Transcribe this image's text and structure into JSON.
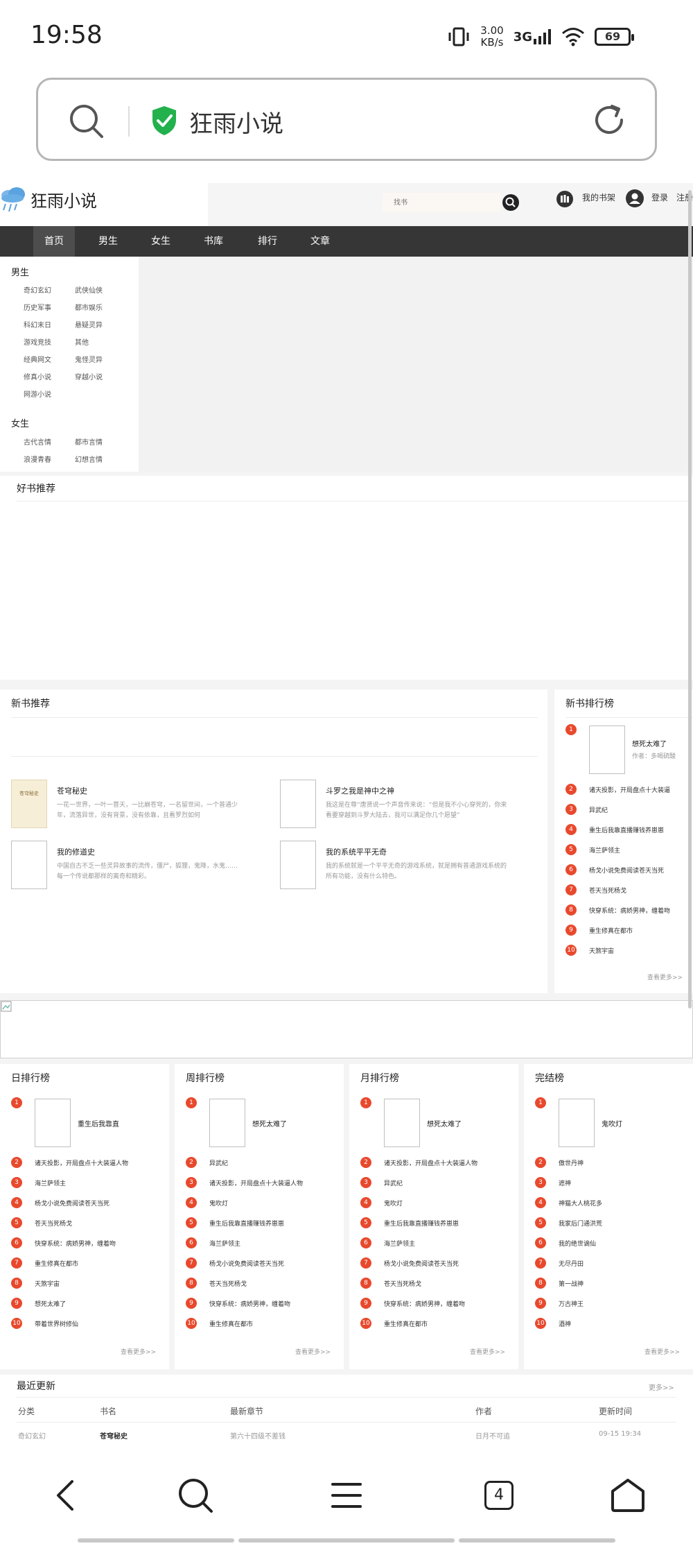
{
  "status": {
    "time": "19:58",
    "net_speed_value": "3.00",
    "net_speed_unit": "KB/s",
    "signal": "3G",
    "battery": "69"
  },
  "address_bar": {
    "site_title": "狂雨小说"
  },
  "site": {
    "logo": "狂雨小说",
    "search_placeholder": "找书",
    "bookshelf": "我的书架",
    "login": "登录",
    "register": "注册"
  },
  "nav": [
    "首页",
    "男生",
    "女生",
    "书库",
    "排行",
    "文章"
  ],
  "categories": {
    "male_title": "男生",
    "male": [
      "奇幻玄幻",
      "武侠仙侠",
      "历史军事",
      "都市娱乐",
      "科幻末日",
      "悬疑灵异",
      "游戏竞技",
      "其他",
      "经典网文",
      "鬼怪灵异",
      "修真小说",
      "穿越小说",
      "网游小说"
    ],
    "female_title": "女生",
    "female": [
      "古代言情",
      "都市言情",
      "浪漫青春",
      "幻想言情"
    ]
  },
  "good_books": {
    "title": "好书推荐"
  },
  "new_books": {
    "title": "新书推荐",
    "items": [
      {
        "title": "苍穹秘史",
        "desc": "一花一世界，一叶一菩天，一比崩苍穹，一名留世间，一个普通少年，流落异世，没有背景，没有依靠，且看罗烈如何",
        "cover_text": "苍穹秘史"
      },
      {
        "title": "斗罗之我是神中之神",
        "desc": "我这是在尊“唐贤说一个声音传来说：“但是我不小心穿死的，你来看要穿越到斗罗大陆去，我可以满足你几个愿望”",
        "cover_text": ""
      },
      {
        "title": "我的修道史",
        "desc": "中国自古不乏一些灵异故事的流传，僵尸，狐狸，鬼降，水鬼……每一个传说都那样的离奇和精彩。",
        "cover_text": ""
      },
      {
        "title": "我的系统平平无奇",
        "desc": "我的系统就是一个平平无奇的游戏系统，就是拥有普通游戏系统的所有功能，没有什么特色。",
        "cover_text": ""
      }
    ]
  },
  "new_rank": {
    "title": "新书排行榜",
    "top": {
      "name": "想死太难了",
      "author": "作者：多喝硫酸"
    },
    "items": [
      "诸天投影，开局盘点十大装逼",
      "异武纪",
      "重生后我靠直播赚钱养崽崽",
      "海兰萨领主",
      "杨戈小说免费阅读苍天当死",
      "苍天当死杨戈",
      "快穿系统：病娇男神，缠着吻",
      "重生修真在都市",
      "天煞宇宙"
    ],
    "more": "查看更多>>"
  },
  "ranks": [
    {
      "title": "日排行榜",
      "top": "重生后我靠直",
      "items": [
        "诸天投影，开局盘点十大装逼人物",
        "海兰萨领主",
        "杨戈小说免费阅读苍天当死",
        "苍天当死杨戈",
        "快穿系统：病娇男神，缠着吻",
        "重生修真在都市",
        "天煞宇宙",
        "想死太难了",
        "带着世界树修仙"
      ],
      "more": "查看更多>>"
    },
    {
      "title": "周排行榜",
      "top": "想死太难了",
      "items": [
        "异武纪",
        "诸天投影，开局盘点十大装逼人物",
        "鬼吹灯",
        "重生后我靠直播赚钱养崽崽",
        "海兰萨领主",
        "杨戈小说免费阅读苍天当死",
        "苍天当死杨戈",
        "快穿系统：病娇男神，缠着吻",
        "重生修真在都市"
      ],
      "more": "查看更多>>"
    },
    {
      "title": "月排行榜",
      "top": "想死太难了",
      "items": [
        "诸天投影，开局盘点十大装逼人物",
        "异武纪",
        "鬼吹灯",
        "重生后我靠直播赚钱养崽崽",
        "海兰萨领主",
        "杨戈小说免费阅读苍天当死",
        "苍天当死杨戈",
        "快穿系统：病娇男神，缠着吻",
        "重生修真在都市"
      ],
      "more": "查看更多>>"
    },
    {
      "title": "完结榜",
      "top": "鬼吹灯",
      "items": [
        "傲世丹神",
        "遮神",
        "神猫大人桃花多",
        "我家后门通洪荒",
        "我的绝世谪仙",
        "无尽丹田",
        "第一战神",
        "万古神王",
        "酒神"
      ],
      "more": "查看更多>>"
    }
  ],
  "recent": {
    "title": "最近更新",
    "more": "更多>>",
    "headers": [
      "分类",
      "书名",
      "最新章节",
      "作者",
      "更新时间"
    ],
    "rows": [
      [
        "奇幻玄幻",
        "苍穹秘史",
        "第六十四级不差钱",
        "日月不可追",
        "09-15 19:34"
      ]
    ]
  },
  "bottom_nav": {
    "tab_count": "4"
  },
  "colors": {
    "rank_badge": "#e8492d",
    "nav_bg": "#363636",
    "shield": "#22b14c"
  }
}
